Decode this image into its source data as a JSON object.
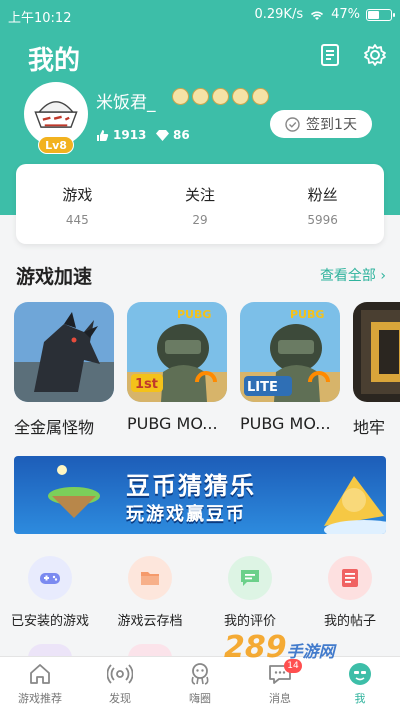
{
  "status_bar": {
    "time": "上午10:12",
    "speed": "0.29K/s",
    "battery": "47%",
    "battery_level": 0.47
  },
  "header": {
    "title": "我的",
    "notes_icon": "notes-icon",
    "settings_icon": "gear-icon"
  },
  "profile": {
    "username": "米饭君_",
    "level": "Lv8",
    "likes": "1913",
    "gems": "86",
    "checkin_label": "签到1天",
    "medal_count": 5
  },
  "stats": [
    {
      "label": "游戏",
      "value": "445"
    },
    {
      "label": "关注",
      "value": "29"
    },
    {
      "label": "粉丝",
      "value": "5996"
    }
  ],
  "acceleration": {
    "title": "游戏加速",
    "see_all": "查看全部",
    "games": [
      {
        "name": "全金属怪物"
      },
      {
        "name": "PUBG MO..."
      },
      {
        "name": "PUBG MO..."
      },
      {
        "name": "地牢"
      }
    ]
  },
  "banner": {
    "line1": "豆币猜猜乐",
    "line2": "玩游戏赢豆币"
  },
  "shortcuts": [
    {
      "label": "已安装的游戏",
      "color": "#7b8af0",
      "icon": "gamepad-icon"
    },
    {
      "label": "游戏云存档",
      "color": "#f59a6b",
      "icon": "folder-icon"
    },
    {
      "label": "我的评价",
      "color": "#6cd08a",
      "icon": "comment-icon"
    },
    {
      "label": "我的帖子",
      "color": "#f06262",
      "icon": "post-icon"
    }
  ],
  "tabs": [
    {
      "label": "游戏推荐",
      "icon": "home-icon"
    },
    {
      "label": "发现",
      "icon": "discover-icon"
    },
    {
      "label": "嗨圈",
      "icon": "circle-icon"
    },
    {
      "label": "消息",
      "icon": "message-icon",
      "badge": "14"
    },
    {
      "label": "我",
      "icon": "me-icon"
    }
  ],
  "watermark": {
    "brand": "289",
    "suffix": "手游网"
  },
  "colors": {
    "accent": "#3dbea8",
    "link": "#2fb39d",
    "badge": "#ff4f4f",
    "level": "#f2b21f"
  }
}
